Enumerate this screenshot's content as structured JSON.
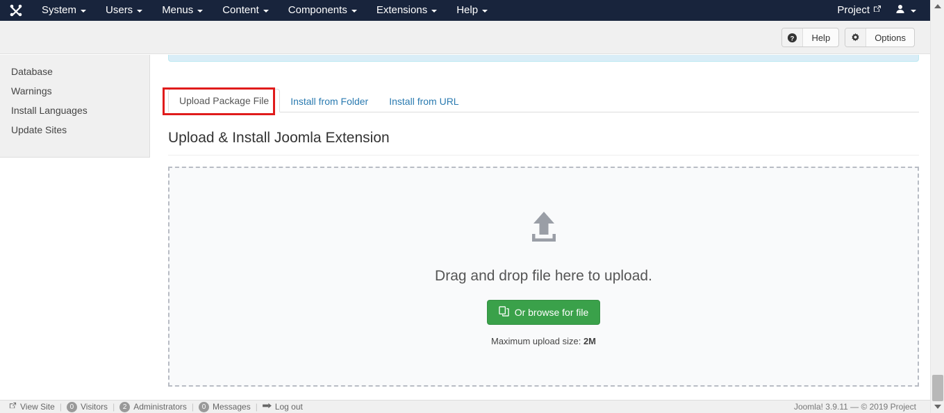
{
  "topnav": {
    "logo_icon": "joomla-logo-icon",
    "menu": [
      {
        "label": "System",
        "caret": true
      },
      {
        "label": "Users",
        "caret": true
      },
      {
        "label": "Menus",
        "caret": true
      },
      {
        "label": "Content",
        "caret": true
      },
      {
        "label": "Components",
        "caret": true
      },
      {
        "label": "Extensions",
        "caret": true
      },
      {
        "label": "Help",
        "caret": true
      }
    ],
    "project_label": "Project",
    "project_icon": "external-link-icon",
    "user_icon": "user-icon"
  },
  "toolbar": {
    "help_label": "Help",
    "help_icon": "question-circle-icon",
    "options_label": "Options",
    "options_icon": "gear-icon"
  },
  "sidebar": {
    "items": [
      {
        "label": "Database"
      },
      {
        "label": "Warnings"
      },
      {
        "label": "Install Languages"
      },
      {
        "label": "Update Sites"
      }
    ]
  },
  "main": {
    "alert_visible": true,
    "tabs": [
      {
        "label": "Upload Package File",
        "active": true
      },
      {
        "label": "Install from Folder",
        "active": false
      },
      {
        "label": "Install from URL",
        "active": false
      }
    ],
    "heading": "Upload & Install Joomla Extension",
    "dropzone": {
      "upload_icon": "upload-arrow-icon",
      "drop_text": "Drag and drop file here to upload.",
      "browse_button_label": "Or browse for file",
      "browse_button_icon": "copy-files-icon",
      "max_size_prefix": "Maximum upload size:",
      "max_size_value": "2M"
    }
  },
  "annotation": {
    "highlight_color": "#e01b1b",
    "target": "Upload Package File"
  },
  "footer": {
    "view_site_label": "View Site",
    "view_site_icon": "external-link-icon",
    "visitors_label": "Visitors",
    "visitors_count": "0",
    "administrators_label": "Administrators",
    "administrators_count": "2",
    "messages_label": "Messages",
    "messages_count": "0",
    "logout_label": "Log out",
    "logout_icon": "logout-icon",
    "separator": "|",
    "version_text": "Joomla! 3.9.11  —  © 2019 Project"
  },
  "scrollbar": {
    "up_icon": "scroll-up-arrow-icon",
    "down_icon": "scroll-down-arrow-icon"
  },
  "colors": {
    "nav_bg": "#18243c",
    "accent_green": "#3aa14a",
    "link_blue": "#2a7ab0",
    "alert_info_bg": "#d9edf7"
  }
}
